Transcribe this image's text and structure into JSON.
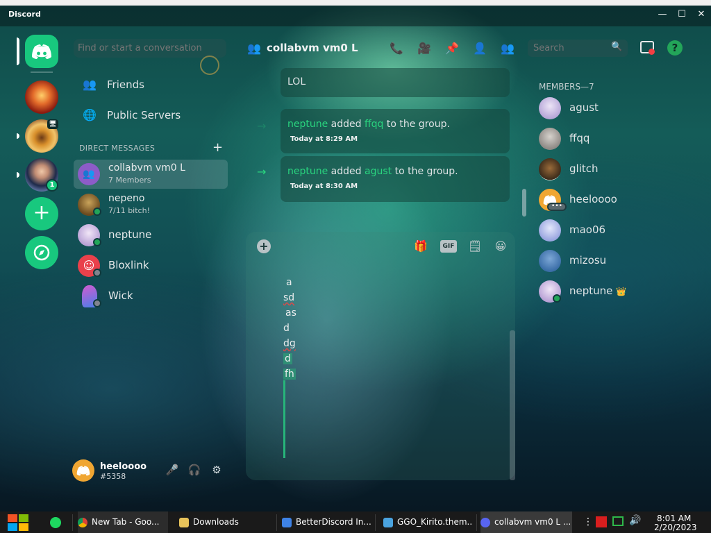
{
  "window": {
    "title": "Discord",
    "minimize": "—",
    "maximize": "☐",
    "close": "✕"
  },
  "servers": {
    "home_label": "Direct Messages",
    "badge_count": "1",
    "add_label": "+",
    "explore_label": "Explore"
  },
  "dm_column": {
    "search_placeholder": "Find or start a conversation",
    "nav": [
      {
        "label": "Friends",
        "icon": "friends-icon"
      },
      {
        "label": "Public Servers",
        "icon": "globe-icon"
      }
    ],
    "section_header": "DIRECT MESSAGES",
    "add_dm": "+",
    "conversations": [
      {
        "name": "collabvm vm0 L",
        "subtitle": "7 Members",
        "active": true,
        "color": "#8c5cc8"
      },
      {
        "name": "nepeno",
        "subtitle": "7/11 bitch!",
        "status": "online",
        "color": "#6b4a1e"
      },
      {
        "name": "neptune",
        "subtitle": "",
        "status": "online",
        "color": "#b9a2d6"
      },
      {
        "name": "Bloxlink",
        "subtitle": "",
        "status": "offline",
        "color": "#e9414b"
      },
      {
        "name": "Wick",
        "subtitle": "",
        "status": "offline",
        "color": "#c44fc8"
      }
    ]
  },
  "user": {
    "name": "heeloooo",
    "tag": "#5358",
    "mic": "🎤",
    "headset": "🎧",
    "settings": "⚙"
  },
  "channel": {
    "name": "collabvm vm0 L",
    "search_placeholder": "Search",
    "help": "?"
  },
  "messages": [
    {
      "type": "text",
      "text": "LOL"
    },
    {
      "type": "system",
      "actor": "neptune",
      "action": " added ",
      "target": "ffqq",
      "suffix": " to the group.",
      "time": "Today at 8:29 AM"
    },
    {
      "type": "system",
      "actor": "neptune",
      "action": " added ",
      "target": "agust",
      "suffix": " to the group.",
      "time": "Today at 8:30 AM"
    }
  ],
  "composer": {
    "plus": "+",
    "gif": "GIF",
    "lines": [
      "a",
      "sd",
      "as",
      "d",
      "dg",
      "d",
      "fh"
    ]
  },
  "members": {
    "header": "MEMBERS—7",
    "list": [
      {
        "name": "agust",
        "color": "#b7a7d8"
      },
      {
        "name": "ffqq",
        "color": "#8f8a86"
      },
      {
        "name": "glitch",
        "color": "#3a2a1a"
      },
      {
        "name": "heeloooo",
        "color": "#f0a632"
      },
      {
        "name": "mao06",
        "color": "#9aa6e0"
      },
      {
        "name": "mizosu",
        "color": "#3b6ea8"
      },
      {
        "name": "neptune",
        "color": "#b9a2d6",
        "crown": "👑"
      }
    ]
  },
  "taskbar": {
    "items": [
      {
        "label": "New Tab - Goo..."
      },
      {
        "label": "Downloads"
      },
      {
        "label": "BetterDiscord In..."
      },
      {
        "label": "GGO_Kirito.them..."
      },
      {
        "label": "collabvm vm0 L ..."
      }
    ],
    "time": "8:01 AM",
    "date": "2/20/2023"
  }
}
